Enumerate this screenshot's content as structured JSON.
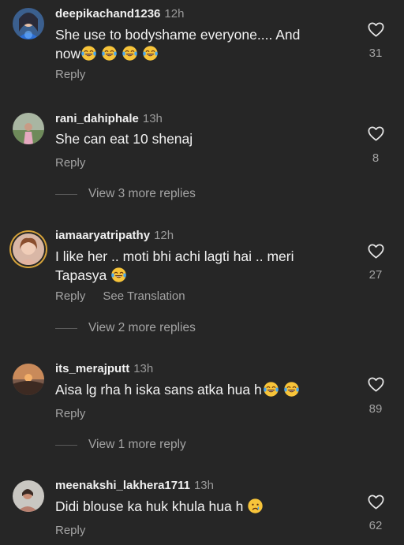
{
  "comments": [
    {
      "username": "deepikachand1236",
      "time": "12h",
      "text_line1": "She use to bodyshame everyone.... And",
      "text_line2": "now",
      "emoji_count": 4,
      "likes": "31",
      "reply_label": "Reply"
    },
    {
      "username": "rani_dahiphale",
      "time": "13h",
      "text_line1": "She can eat 10 shenaj",
      "likes": "8",
      "reply_label": "Reply",
      "more_replies": "View 3 more replies"
    },
    {
      "username": "iamaaryatripathy",
      "time": "12h",
      "text_line1": "I like her .. moti bhi achi lagti hai .. meri",
      "text_line2": "Tapasya",
      "likes": "27",
      "reply_label": "Reply",
      "translate_label": "See Translation",
      "more_replies": "View 2 more replies"
    },
    {
      "username": "its_merajputt",
      "time": "13h",
      "text_line1": "Aisa lg rha h iska sans atka hua h",
      "likes": "89",
      "reply_label": "Reply",
      "more_replies": "View 1 more reply"
    },
    {
      "username": "meenakshi_lakhera1711",
      "time": "13h",
      "text_line1": "Didi blouse ka huk khula hua h",
      "likes": "62",
      "reply_label": "Reply"
    }
  ],
  "icons": {
    "like": "heart-outline-icon",
    "laugh": "tears-of-joy-emoji",
    "cry": "crying-face-emoji"
  }
}
